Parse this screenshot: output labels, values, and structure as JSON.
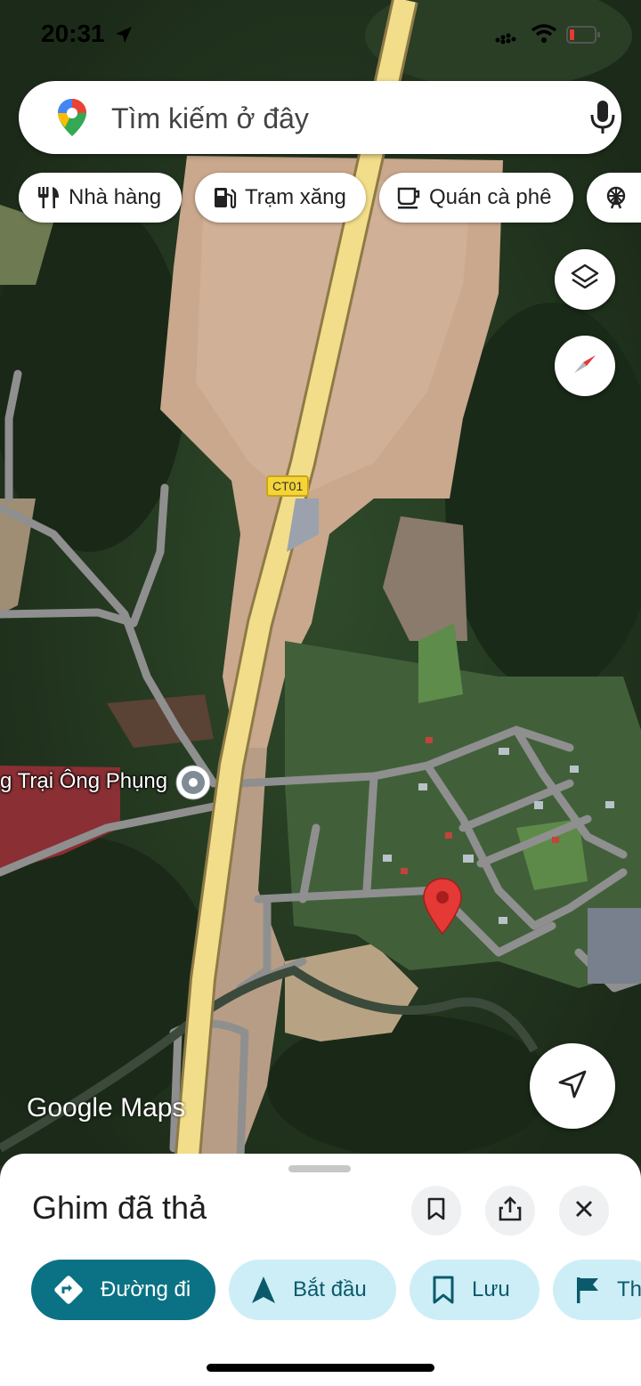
{
  "status": {
    "time": "20:31"
  },
  "search": {
    "placeholder": "Tìm kiếm ở đây"
  },
  "chips": [
    {
      "label": "Nhà hàng",
      "icon": "restaurant-icon"
    },
    {
      "label": "Trạm xăng",
      "icon": "gas-station-icon"
    },
    {
      "label": "Quán cà phê",
      "icon": "coffee-icon"
    },
    {
      "label": "",
      "icon": "attraction-icon"
    }
  ],
  "map": {
    "road_label": "CT01",
    "place_label": "g Trại Ông Phụng",
    "watermark": "Google Maps"
  },
  "sheet": {
    "title": "Ghim đã thả",
    "actions": [
      {
        "label": "Đường đi",
        "icon": "directions-icon"
      },
      {
        "label": "Bắt đầu",
        "icon": "navigation-arrow-icon"
      },
      {
        "label": "Lưu",
        "icon": "bookmark-icon"
      },
      {
        "label": "Th",
        "icon": "flag-icon"
      }
    ]
  },
  "colors": {
    "primary": "#0b7285",
    "chip_light": "#cdeef6",
    "pin": "#e53935",
    "road": "#f2dd8a"
  }
}
